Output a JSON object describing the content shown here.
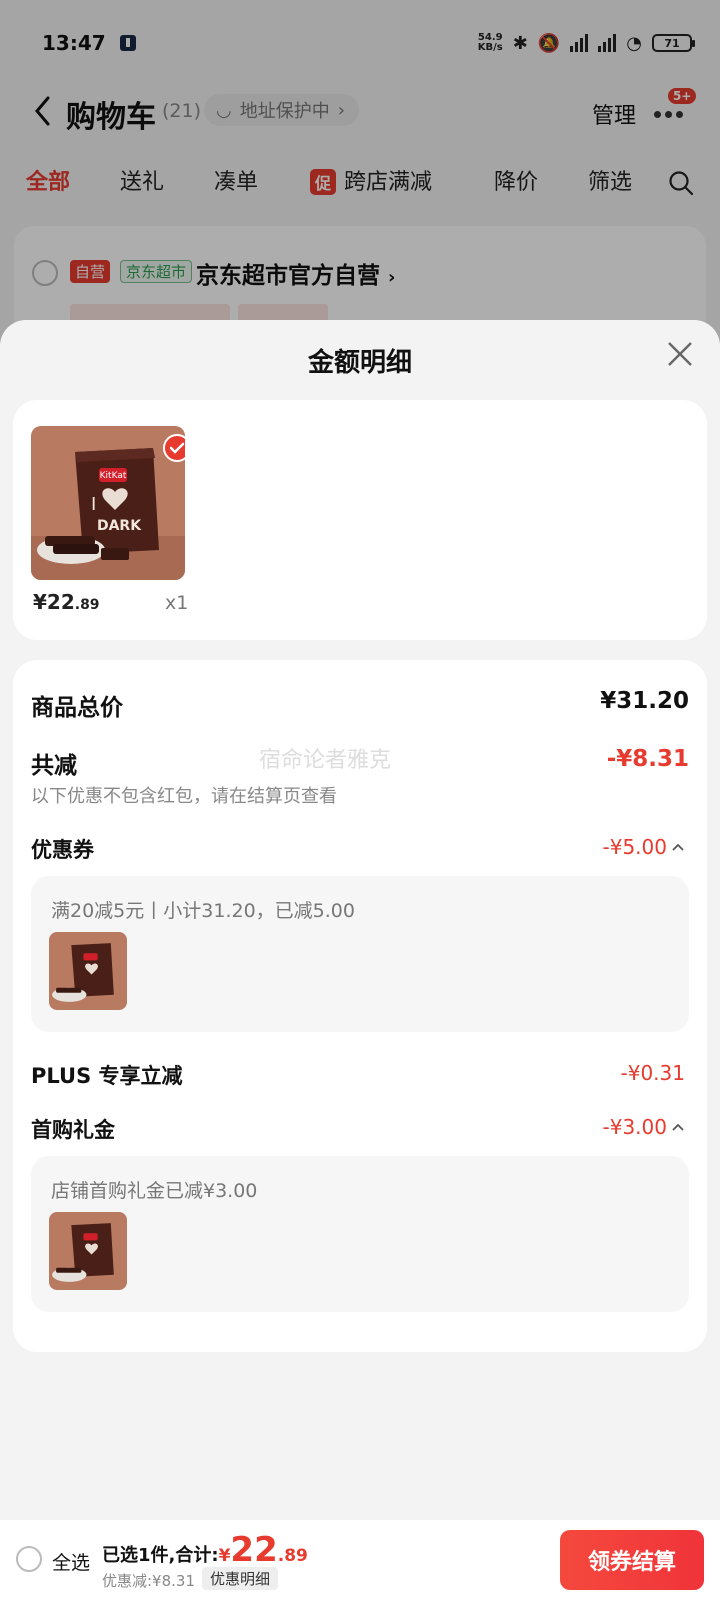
{
  "status_bar": {
    "time": "13:47",
    "net_speed_value": "54.9",
    "net_speed_unit": "KB/s",
    "battery": "71"
  },
  "header": {
    "title": "购物车",
    "count": "(21)",
    "address": "地址保护中",
    "manage": "管理",
    "badge": "5+"
  },
  "tabs": [
    {
      "label": "全部"
    },
    {
      "label": "送礼"
    },
    {
      "label": "凑单"
    },
    {
      "label": "跨店满减",
      "tag": "促"
    },
    {
      "label": "降价"
    },
    {
      "label": "筛选"
    }
  ],
  "store": {
    "tag_self": "自营",
    "tag_jd": "京东超市",
    "name": "京东超市官方自营"
  },
  "sheet": {
    "title": "金额明细",
    "product": {
      "price_int": "¥22",
      "price_dec": ".89",
      "qty": "x1",
      "brand": "KitKat",
      "pack_text": "DARK"
    },
    "total_price_label": "商品总价",
    "total_price": "¥31.20",
    "total_discount_label": "共减",
    "total_discount": "-¥8.31",
    "discount_note": "以下优惠不包含红包，请在结算页查看",
    "watermark": "宿命论者雅克",
    "coupon": {
      "label": "优惠券",
      "value": "-¥5.00",
      "detail": "满20减5元丨小计31.20，已减5.00"
    },
    "plus": {
      "label": "PLUS 专享立减",
      "value": "-¥0.31"
    },
    "first_gift": {
      "label": "首购礼金",
      "value": "-¥3.00",
      "detail": "店铺首购礼金已减¥3.00"
    }
  },
  "bottom": {
    "select_all": "全选",
    "selected_text": "已选1件,合计:",
    "total_cur": "¥",
    "total_int": "22",
    "total_dec": ".89",
    "discount_text": "优惠减:¥8.31",
    "discount_detail_btn": "优惠明细",
    "checkout": "领券结算"
  },
  "colors": {
    "accent": "#e63b2e"
  }
}
